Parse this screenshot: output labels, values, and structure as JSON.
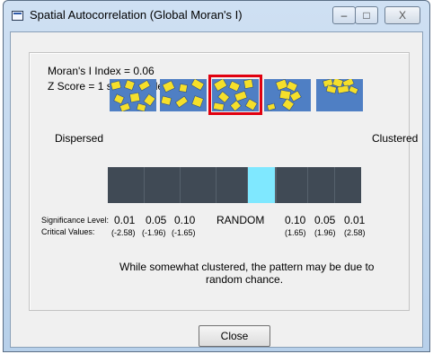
{
  "window": {
    "title": "Spatial Autocorrelation (Global Moran's I)",
    "controls": {
      "minimize": "–",
      "maximize": "□",
      "close": "X"
    }
  },
  "stats": {
    "index_text": "Moran's I Index = 0.06",
    "zscore_text": "Z Score = 1 standard deviations"
  },
  "scale": {
    "left_label": "Dispersed",
    "right_label": "Clustered",
    "selected_pattern_index": 2,
    "patterns": [
      "dispersed",
      "somewhat dispersed",
      "random",
      "somewhat clustered",
      "clustered"
    ]
  },
  "significance": {
    "level_label": "Significance Level:",
    "critical_label": "Critical Values:",
    "levels": [
      "0.01",
      "0.05",
      "0.10",
      "RANDOM",
      "0.10",
      "0.05",
      "0.01"
    ],
    "critical_values": [
      "(-2.58)",
      "(-1.96)",
      "(-1.65)",
      "(1.65)",
      "(1.96)",
      "(2.58)"
    ]
  },
  "message": {
    "line1": "While somewhat clustered, the pattern may be due to",
    "line2": "random chance."
  },
  "buttons": {
    "close": "Close"
  },
  "colors": {
    "random_highlight": "#7fe8ff",
    "bar": "#404a55",
    "selection_frame": "#e1000f",
    "pattern_blue": "#4f7fc4",
    "pattern_yellow": "#f5df2a"
  }
}
